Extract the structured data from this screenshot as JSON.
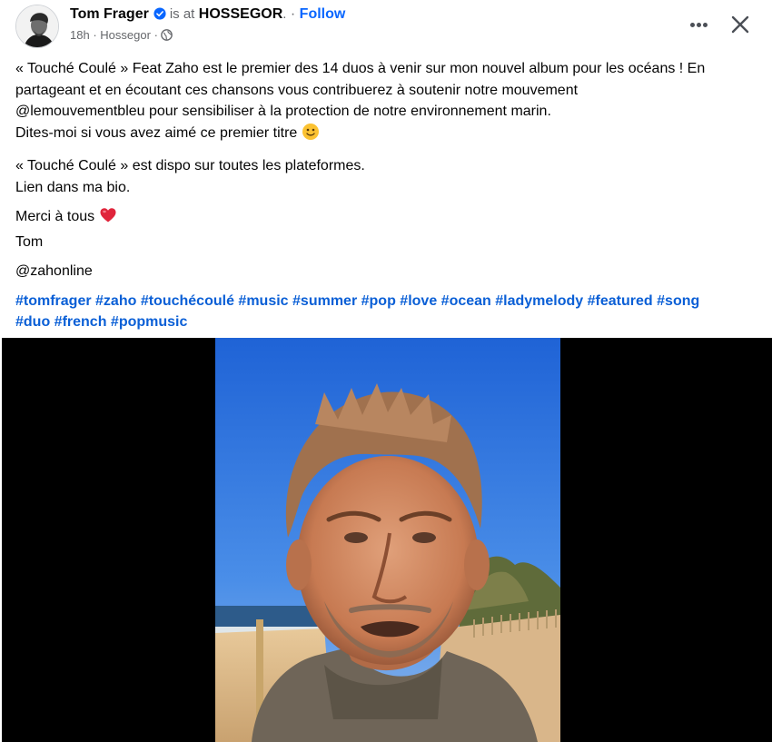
{
  "author": {
    "name": "Tom Frager",
    "is_at": "is at",
    "place": "HOSSEGOR",
    "place_suffix": ".",
    "separator": "·",
    "follow": "Follow",
    "time": "18h",
    "location": "Hossegor",
    "meta_separator": "·",
    "privacy_icon": "globe-icon",
    "verified_icon": "verified-badge-icon"
  },
  "actions": {
    "more_icon": "more-options-icon",
    "close_icon": "close-icon"
  },
  "post": {
    "p1_l1": "« Touché Coulé » Feat Zaho est le premier des 14 duos à venir sur mon nouvel album pour les océans ! En",
    "p1_l2": "partageant et en écoutant ces chansons vous contribuerez à soutenir notre mouvement",
    "p1_l3": "@lemouvementbleu pour sensibiliser à la protection de notre environnement marin.",
    "p1_l4": "Dites-moi si vous avez aimé ce premier titre",
    "p2_l1": "« Touché Coulé » est dispo sur toutes les plateformes.",
    "p2_l2": "Lien dans ma bio.",
    "p3_l1": "Merci à tous",
    "p3_l2": "Tom",
    "p4": "@zahonline",
    "hashtags": [
      "#tomfrager",
      "#zaho",
      "#touchécoulé",
      "#music",
      "#summer",
      "#pop",
      "#love",
      "#ocean",
      "#ladymelody",
      "#featured",
      "#song",
      "#duo",
      "#french",
      "#popmusic"
    ],
    "emoji_smile": "slightly-smiling-face-emoji",
    "emoji_heart": "red-heart-emoji"
  },
  "media": {
    "type": "video",
    "description_icon": "video-player"
  },
  "colors": {
    "link": "#0a5fd6",
    "follow": "#0866ff",
    "secondary_text": "#65676b",
    "verified": "#0866ff"
  }
}
